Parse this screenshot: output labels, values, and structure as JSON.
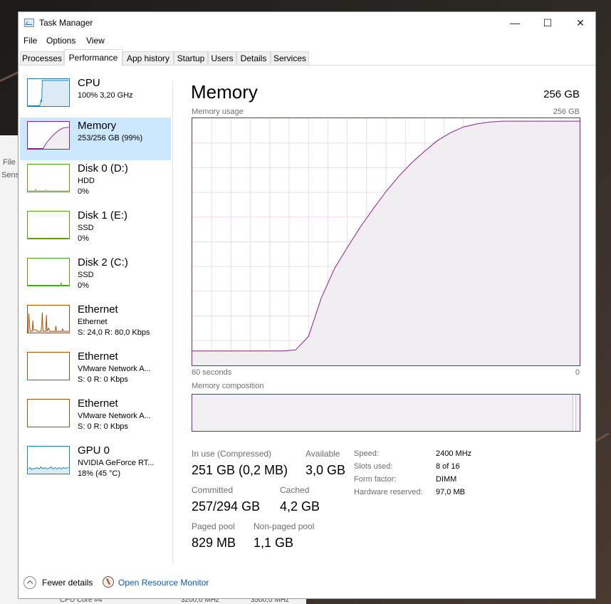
{
  "window": {
    "title": "Task Manager",
    "minimize": "—",
    "maximize": "☐",
    "close": "✕"
  },
  "menu": [
    "File",
    "Options",
    "View"
  ],
  "tabs": [
    "Processes",
    "Performance",
    "App history",
    "Startup",
    "Users",
    "Details",
    "Services"
  ],
  "active_tab": "Performance",
  "background_window": {
    "items": [
      "File",
      "Sens"
    ]
  },
  "background_footer": [
    "CPU Core #4",
    "3200,0 MHz",
    "3500,0 MHz"
  ],
  "sidebar": {
    "items": [
      {
        "name": "CPU",
        "line1": "100% 3,20 GHz",
        "line2": ""
      },
      {
        "name": "Memory",
        "line1": "253/256 GB (99%)",
        "line2": ""
      },
      {
        "name": "Disk 0 (D:)",
        "line1": "HDD",
        "line2": "0%"
      },
      {
        "name": "Disk 1 (E:)",
        "line1": "SSD",
        "line2": "0%"
      },
      {
        "name": "Disk 2 (C:)",
        "line1": "SSD",
        "line2": "0%"
      },
      {
        "name": "Ethernet",
        "line1": "Ethernet",
        "line2": "S: 24,0  R: 80,0 Kbps"
      },
      {
        "name": "Ethernet",
        "line1": "VMware Network A...",
        "line2": "S: 0  R: 0 Kbps"
      },
      {
        "name": "Ethernet",
        "line1": "VMware Network A...",
        "line2": "S: 0  R: 0 Kbps"
      },
      {
        "name": "GPU 0",
        "line1": "NVIDIA GeForce RT...",
        "line2": "18% (45 °C)"
      }
    ],
    "selected": 1
  },
  "main": {
    "title": "Memory",
    "total": "256 GB",
    "usage_label": "Memory usage",
    "usage_max": "256 GB",
    "time_left": "60 seconds",
    "time_right": "0",
    "composition_label": "Memory composition"
  },
  "chart_data": {
    "type": "area",
    "title": "Memory usage",
    "x": [
      60,
      58,
      56,
      54,
      52,
      50,
      48,
      46,
      44,
      42,
      40,
      38,
      36,
      34,
      32,
      30,
      28,
      26,
      24,
      22,
      20,
      18,
      16,
      14,
      12,
      10,
      8,
      6,
      4,
      2,
      0
    ],
    "y": [
      15,
      15,
      15,
      15,
      15,
      15,
      15,
      15,
      16,
      30,
      70,
      100,
      122,
      143,
      162,
      180,
      196,
      210,
      222,
      233,
      241,
      247,
      250,
      252,
      253,
      253,
      253,
      253,
      253,
      253,
      253
    ],
    "ylim": [
      0,
      256
    ],
    "xlim": [
      60,
      0
    ],
    "xlabel_left": "60 seconds",
    "xlabel_right": "0",
    "ylabel": "256 GB",
    "grid": true,
    "color": "#8b1e8f",
    "fill": "#f1edf3"
  },
  "stats": {
    "in_use_label": "In use (Compressed)",
    "in_use": "251 GB (0,2 MB)",
    "available_label": "Available",
    "available": "3,0 GB",
    "committed_label": "Committed",
    "committed": "257/294 GB",
    "cached_label": "Cached",
    "cached": "4,2 GB",
    "paged_label": "Paged pool",
    "paged": "829 MB",
    "nonpaged_label": "Non-paged pool",
    "nonpaged": "1,1 GB"
  },
  "specs": [
    {
      "label": "Speed:",
      "value": "2400 MHz"
    },
    {
      "label": "Slots used:",
      "value": "8 of 16"
    },
    {
      "label": "Form factor:",
      "value": "DIMM"
    },
    {
      "label": "Hardware reserved:",
      "value": "97,0 MB"
    }
  ],
  "footer": {
    "fewer": "Fewer details",
    "resource_monitor": "Open Resource Monitor"
  },
  "colors": {
    "memory": "#8b1e8f",
    "cpu": "#1a80bb",
    "disk": "#4da60c",
    "ethernet": "#a74f01",
    "gpu": "#1a80bb",
    "selection": "#cce8ff",
    "link": "#0b5bab"
  }
}
